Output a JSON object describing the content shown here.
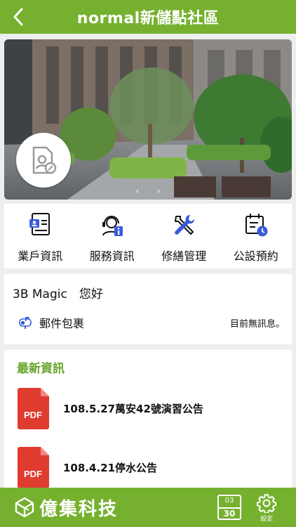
{
  "header": {
    "title": "normal新儲點社區"
  },
  "banner": {
    "prev": "‹",
    "next": "›"
  },
  "menu": [
    {
      "label": "業戶資訊"
    },
    {
      "label": "服務資訊"
    },
    {
      "label": "修繕管理"
    },
    {
      "label": "公設預約"
    }
  ],
  "greeting": {
    "text": "3B Magic　您好",
    "mail_label": "郵件包裹",
    "mail_status": "目前無訊息。"
  },
  "news": {
    "title": "最新資訊",
    "items": [
      {
        "text": "108.5.27萬安42號演習公告",
        "icon_label": "PDF"
      },
      {
        "text": "108.4.21停水公告",
        "icon_label": "PDF"
      }
    ]
  },
  "bottom": {
    "brand": "億集科技",
    "calendar_month": "03",
    "calendar_day": "30",
    "settings_label": "設定"
  },
  "colors": {
    "primary": "#75b12f",
    "accent": "#3b5bdb",
    "pdf": "#e03b2f"
  }
}
